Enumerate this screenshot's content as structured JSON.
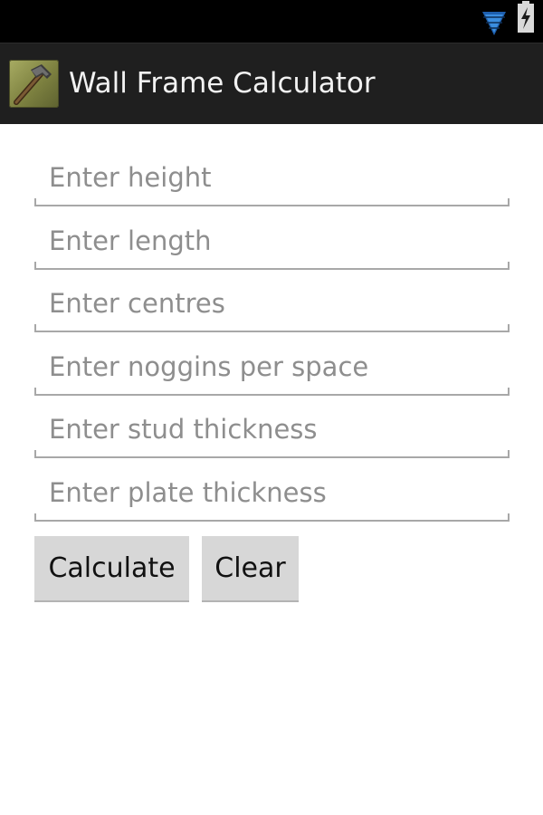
{
  "status_bar": {
    "icons": [
      "wifi-icon",
      "battery-charging-icon"
    ],
    "wifi_color": "#2f7ccf"
  },
  "action_bar": {
    "icon": "hammer-icon",
    "title": "Wall Frame Calculator",
    "background": "#1f1f1f"
  },
  "form": {
    "fields": [
      {
        "placeholder": "Enter height",
        "value": ""
      },
      {
        "placeholder": "Enter length",
        "value": ""
      },
      {
        "placeholder": "Enter centres",
        "value": ""
      },
      {
        "placeholder": "Enter noggins per space",
        "value": ""
      },
      {
        "placeholder": "Enter stud thickness",
        "value": ""
      },
      {
        "placeholder": "Enter plate thickness",
        "value": ""
      }
    ],
    "buttons": {
      "calculate_label": "Calculate",
      "clear_label": "Clear"
    }
  }
}
